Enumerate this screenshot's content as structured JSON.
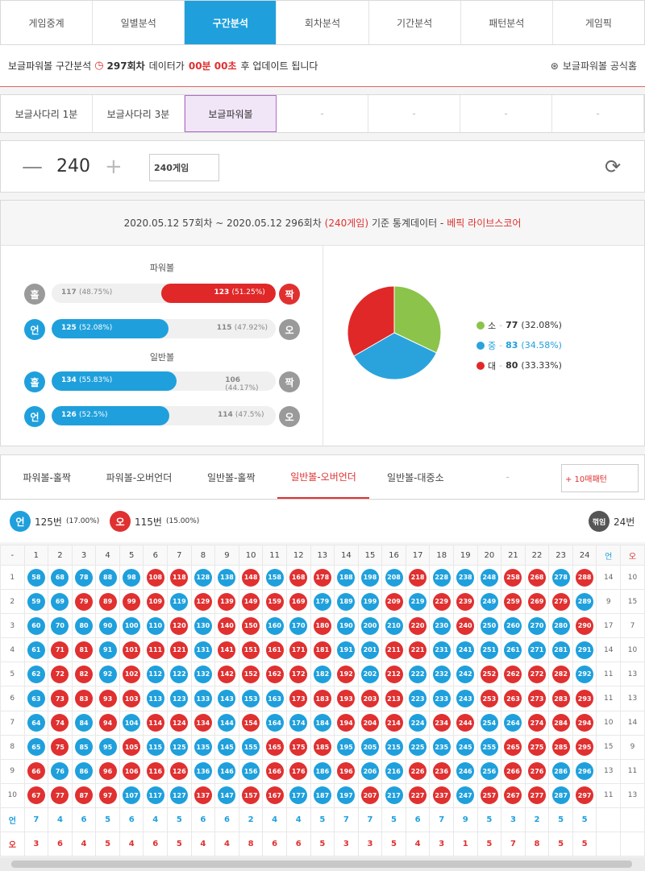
{
  "nav": {
    "tabs": [
      "게임중계",
      "일별분석",
      "구간분석",
      "회차분석",
      "기간분석",
      "패턴분석",
      "게임픽"
    ],
    "active_index": 2
  },
  "notice": {
    "prefix": "보글파워볼 구간분석",
    "round": "297회차",
    "mid": "데이터가",
    "time": "00분 00초",
    "suffix": "후 업데이트 됩니다",
    "link": "보글파워볼 공식홈"
  },
  "subtabs": [
    "보글사다리 1분",
    "보글사다리 3분",
    "보글파워볼",
    "-",
    "-",
    "-",
    "-"
  ],
  "counter": {
    "minus": "—",
    "value": "240",
    "plus": "+",
    "input_value": "240게임"
  },
  "stats_header": {
    "range": "2020.05.12 57회차 ~ 2020.05.12 296회차",
    "count": "(240게임)",
    "base": "기준 통계데이터 -",
    "source": "베픽 라이브스코어"
  },
  "powerball": {
    "title": "파워볼",
    "oddeven": {
      "left_glyph": "홀",
      "left_text": "117",
      "left_pct": "(48.75%)",
      "right_text": "123",
      "right_pct": "(51.25%)",
      "right_glyph": "짝",
      "right_share": 0.5125
    },
    "underover": {
      "left_glyph": "언",
      "left_text": "125",
      "left_pct": "(52.08%)",
      "right_text": "115",
      "right_pct": "(47.92%)",
      "right_glyph": "오",
      "left_share": 0.5208
    }
  },
  "normalball": {
    "title": "일반볼",
    "oddeven": {
      "left_glyph": "홀",
      "left_text": "134",
      "left_pct": "(55.83%)",
      "right_text": "106",
      "right_pct": "(44.17%)",
      "right_glyph": "짝",
      "left_share": 0.5583
    },
    "underover": {
      "left_glyph": "언",
      "left_text": "126",
      "left_pct": "(52.5%)",
      "right_text": "114",
      "right_pct": "(47.5%)",
      "right_glyph": "오",
      "left_share": 0.525
    }
  },
  "chart_data": {
    "type": "pie",
    "categories": [
      "소",
      "중",
      "대"
    ],
    "values": [
      77,
      83,
      80
    ],
    "percent_labels": [
      "(32.08%)",
      "(34.58%)",
      "(33.33%)"
    ],
    "colors": [
      "#8cc34a",
      "#2aa3dc",
      "#e02828"
    ]
  },
  "pattern_tabs": [
    "파워볼-홀짝",
    "파워볼-오버언더",
    "일반볼-홀짝",
    "일반볼-오버언더",
    "일반볼-대중소",
    "-"
  ],
  "pattern_active": 3,
  "pattern_button": "+ 10매패턴",
  "summary": {
    "under_glyph": "언",
    "under_count": "125번",
    "under_pct": "(17.00%)",
    "over_glyph": "오",
    "over_count": "115번",
    "over_pct": "(15.00%)",
    "turn_glyph": "꺾임",
    "turn_count": "24번"
  },
  "grid": {
    "corner": "-",
    "columns": [
      "1",
      "2",
      "3",
      "4",
      "5",
      "6",
      "7",
      "8",
      "9",
      "10",
      "11",
      "12",
      "13",
      "14",
      "15",
      "16",
      "17",
      "18",
      "19",
      "20",
      "21",
      "22",
      "23",
      "24"
    ],
    "side_headers": [
      "언",
      "오"
    ],
    "rows": [
      {
        "n": "1",
        "balls": [
          [
            "58",
            "b"
          ],
          [
            "68",
            "b"
          ],
          [
            "78",
            "b"
          ],
          [
            "88",
            "b"
          ],
          [
            "98",
            "b"
          ],
          [
            "108",
            "r"
          ],
          [
            "118",
            "r"
          ],
          [
            "128",
            "b"
          ],
          [
            "138",
            "b"
          ],
          [
            "148",
            "r"
          ],
          [
            "158",
            "b"
          ],
          [
            "168",
            "r"
          ],
          [
            "178",
            "r"
          ],
          [
            "188",
            "b"
          ],
          [
            "198",
            "b"
          ],
          [
            "208",
            "b"
          ],
          [
            "218",
            "r"
          ],
          [
            "228",
            "b"
          ],
          [
            "238",
            "b"
          ],
          [
            "248",
            "b"
          ],
          [
            "258",
            "r"
          ],
          [
            "268",
            "r"
          ],
          [
            "278",
            "b"
          ],
          [
            "288",
            "r"
          ]
        ],
        "u": "14",
        "o": "10"
      },
      {
        "n": "2",
        "balls": [
          [
            "59",
            "b"
          ],
          [
            "69",
            "b"
          ],
          [
            "79",
            "r"
          ],
          [
            "89",
            "r"
          ],
          [
            "99",
            "r"
          ],
          [
            "109",
            "r"
          ],
          [
            "119",
            "b"
          ],
          [
            "129",
            "r"
          ],
          [
            "139",
            "r"
          ],
          [
            "149",
            "r"
          ],
          [
            "159",
            "r"
          ],
          [
            "169",
            "r"
          ],
          [
            "179",
            "b"
          ],
          [
            "189",
            "b"
          ],
          [
            "199",
            "b"
          ],
          [
            "209",
            "r"
          ],
          [
            "219",
            "b"
          ],
          [
            "229",
            "r"
          ],
          [
            "239",
            "r"
          ],
          [
            "249",
            "b"
          ],
          [
            "259",
            "r"
          ],
          [
            "269",
            "r"
          ],
          [
            "279",
            "r"
          ],
          [
            "289",
            "b"
          ]
        ],
        "u": "9",
        "o": "15"
      },
      {
        "n": "3",
        "balls": [
          [
            "60",
            "b"
          ],
          [
            "70",
            "b"
          ],
          [
            "80",
            "b"
          ],
          [
            "90",
            "b"
          ],
          [
            "100",
            "b"
          ],
          [
            "110",
            "b"
          ],
          [
            "120",
            "r"
          ],
          [
            "130",
            "b"
          ],
          [
            "140",
            "r"
          ],
          [
            "150",
            "r"
          ],
          [
            "160",
            "b"
          ],
          [
            "170",
            "b"
          ],
          [
            "180",
            "r"
          ],
          [
            "190",
            "b"
          ],
          [
            "200",
            "b"
          ],
          [
            "210",
            "b"
          ],
          [
            "220",
            "r"
          ],
          [
            "230",
            "b"
          ],
          [
            "240",
            "r"
          ],
          [
            "250",
            "b"
          ],
          [
            "260",
            "b"
          ],
          [
            "270",
            "b"
          ],
          [
            "280",
            "b"
          ],
          [
            "290",
            "r"
          ]
        ],
        "u": "17",
        "o": "7"
      },
      {
        "n": "4",
        "balls": [
          [
            "61",
            "b"
          ],
          [
            "71",
            "r"
          ],
          [
            "81",
            "r"
          ],
          [
            "91",
            "b"
          ],
          [
            "101",
            "r"
          ],
          [
            "111",
            "r"
          ],
          [
            "121",
            "r"
          ],
          [
            "131",
            "b"
          ],
          [
            "141",
            "r"
          ],
          [
            "151",
            "r"
          ],
          [
            "161",
            "r"
          ],
          [
            "171",
            "r"
          ],
          [
            "181",
            "r"
          ],
          [
            "191",
            "b"
          ],
          [
            "201",
            "b"
          ],
          [
            "211",
            "r"
          ],
          [
            "221",
            "r"
          ],
          [
            "231",
            "b"
          ],
          [
            "241",
            "b"
          ],
          [
            "251",
            "b"
          ],
          [
            "261",
            "b"
          ],
          [
            "271",
            "b"
          ],
          [
            "281",
            "b"
          ],
          [
            "291",
            "b"
          ]
        ],
        "u": "14",
        "o": "10"
      },
      {
        "n": "5",
        "balls": [
          [
            "62",
            "b"
          ],
          [
            "72",
            "r"
          ],
          [
            "82",
            "r"
          ],
          [
            "92",
            "b"
          ],
          [
            "102",
            "r"
          ],
          [
            "112",
            "b"
          ],
          [
            "122",
            "b"
          ],
          [
            "132",
            "b"
          ],
          [
            "142",
            "r"
          ],
          [
            "152",
            "r"
          ],
          [
            "162",
            "r"
          ],
          [
            "172",
            "r"
          ],
          [
            "182",
            "b"
          ],
          [
            "192",
            "r"
          ],
          [
            "202",
            "b"
          ],
          [
            "212",
            "r"
          ],
          [
            "222",
            "b"
          ],
          [
            "232",
            "b"
          ],
          [
            "242",
            "b"
          ],
          [
            "252",
            "r"
          ],
          [
            "262",
            "r"
          ],
          [
            "272",
            "r"
          ],
          [
            "282",
            "r"
          ],
          [
            "292",
            "b"
          ]
        ],
        "u": "11",
        "o": "13"
      },
      {
        "n": "6",
        "balls": [
          [
            "63",
            "b"
          ],
          [
            "73",
            "r"
          ],
          [
            "83",
            "r"
          ],
          [
            "93",
            "r"
          ],
          [
            "103",
            "r"
          ],
          [
            "113",
            "b"
          ],
          [
            "123",
            "b"
          ],
          [
            "133",
            "b"
          ],
          [
            "143",
            "b"
          ],
          [
            "153",
            "b"
          ],
          [
            "163",
            "b"
          ],
          [
            "173",
            "r"
          ],
          [
            "183",
            "r"
          ],
          [
            "193",
            "r"
          ],
          [
            "203",
            "r"
          ],
          [
            "213",
            "r"
          ],
          [
            "223",
            "b"
          ],
          [
            "233",
            "b"
          ],
          [
            "243",
            "b"
          ],
          [
            "253",
            "r"
          ],
          [
            "263",
            "r"
          ],
          [
            "273",
            "r"
          ],
          [
            "283",
            "r"
          ],
          [
            "293",
            "r"
          ]
        ],
        "u": "11",
        "o": "13"
      },
      {
        "n": "7",
        "balls": [
          [
            "64",
            "b"
          ],
          [
            "74",
            "r"
          ],
          [
            "84",
            "b"
          ],
          [
            "94",
            "r"
          ],
          [
            "104",
            "b"
          ],
          [
            "114",
            "r"
          ],
          [
            "124",
            "r"
          ],
          [
            "134",
            "r"
          ],
          [
            "144",
            "b"
          ],
          [
            "154",
            "r"
          ],
          [
            "164",
            "b"
          ],
          [
            "174",
            "b"
          ],
          [
            "184",
            "b"
          ],
          [
            "194",
            "r"
          ],
          [
            "204",
            "r"
          ],
          [
            "214",
            "r"
          ],
          [
            "224",
            "b"
          ],
          [
            "234",
            "r"
          ],
          [
            "244",
            "r"
          ],
          [
            "254",
            "b"
          ],
          [
            "264",
            "b"
          ],
          [
            "274",
            "r"
          ],
          [
            "284",
            "r"
          ],
          [
            "294",
            "r"
          ]
        ],
        "u": "10",
        "o": "14"
      },
      {
        "n": "8",
        "balls": [
          [
            "65",
            "b"
          ],
          [
            "75",
            "r"
          ],
          [
            "85",
            "b"
          ],
          [
            "95",
            "b"
          ],
          [
            "105",
            "r"
          ],
          [
            "115",
            "b"
          ],
          [
            "125",
            "b"
          ],
          [
            "135",
            "b"
          ],
          [
            "145",
            "b"
          ],
          [
            "155",
            "b"
          ],
          [
            "165",
            "r"
          ],
          [
            "175",
            "r"
          ],
          [
            "185",
            "r"
          ],
          [
            "195",
            "b"
          ],
          [
            "205",
            "b"
          ],
          [
            "215",
            "b"
          ],
          [
            "225",
            "b"
          ],
          [
            "235",
            "b"
          ],
          [
            "245",
            "b"
          ],
          [
            "255",
            "b"
          ],
          [
            "265",
            "r"
          ],
          [
            "275",
            "r"
          ],
          [
            "285",
            "r"
          ],
          [
            "295",
            "r"
          ]
        ],
        "u": "15",
        "o": "9"
      },
      {
        "n": "9",
        "balls": [
          [
            "66",
            "r"
          ],
          [
            "76",
            "b"
          ],
          [
            "86",
            "b"
          ],
          [
            "96",
            "r"
          ],
          [
            "106",
            "r"
          ],
          [
            "116",
            "r"
          ],
          [
            "126",
            "r"
          ],
          [
            "136",
            "b"
          ],
          [
            "146",
            "b"
          ],
          [
            "156",
            "b"
          ],
          [
            "166",
            "r"
          ],
          [
            "176",
            "r"
          ],
          [
            "186",
            "b"
          ],
          [
            "196",
            "r"
          ],
          [
            "206",
            "b"
          ],
          [
            "216",
            "b"
          ],
          [
            "226",
            "r"
          ],
          [
            "236",
            "r"
          ],
          [
            "246",
            "b"
          ],
          [
            "256",
            "b"
          ],
          [
            "266",
            "r"
          ],
          [
            "276",
            "r"
          ],
          [
            "286",
            "b"
          ],
          [
            "296",
            "b"
          ]
        ],
        "u": "13",
        "o": "11"
      },
      {
        "n": "10",
        "balls": [
          [
            "67",
            "r"
          ],
          [
            "77",
            "r"
          ],
          [
            "87",
            "r"
          ],
          [
            "97",
            "r"
          ],
          [
            "107",
            "b"
          ],
          [
            "117",
            "b"
          ],
          [
            "127",
            "b"
          ],
          [
            "137",
            "r"
          ],
          [
            "147",
            "b"
          ],
          [
            "157",
            "r"
          ],
          [
            "167",
            "r"
          ],
          [
            "177",
            "b"
          ],
          [
            "187",
            "b"
          ],
          [
            "197",
            "b"
          ],
          [
            "207",
            "r"
          ],
          [
            "217",
            "b"
          ],
          [
            "227",
            "r"
          ],
          [
            "237",
            "r"
          ],
          [
            "247",
            "b"
          ],
          [
            "257",
            "r"
          ],
          [
            "267",
            "r"
          ],
          [
            "277",
            "r"
          ],
          [
            "287",
            "b"
          ],
          [
            "297",
            "r"
          ]
        ],
        "u": "11",
        "o": "13"
      }
    ],
    "foot_under_label": "언",
    "foot_under": [
      "7",
      "4",
      "6",
      "5",
      "6",
      "4",
      "5",
      "6",
      "6",
      "2",
      "4",
      "4",
      "5",
      "7",
      "7",
      "5",
      "6",
      "7",
      "9",
      "5",
      "3",
      "2",
      "5",
      "5"
    ],
    "foot_over_label": "오",
    "foot_over": [
      "3",
      "6",
      "4",
      "5",
      "4",
      "6",
      "5",
      "4",
      "4",
      "8",
      "6",
      "6",
      "5",
      "3",
      "3",
      "5",
      "4",
      "3",
      "1",
      "5",
      "7",
      "8",
      "5",
      "5"
    ]
  }
}
